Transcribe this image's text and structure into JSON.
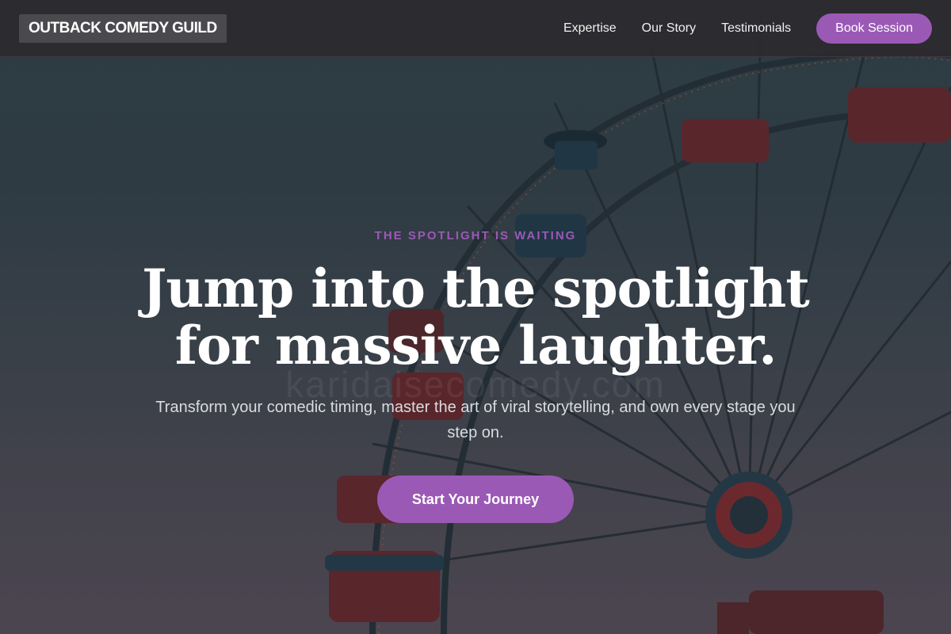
{
  "nav": {
    "brand": "OUTBACK COMEDY GUILD",
    "links": [
      "Expertise",
      "Our Story",
      "Testimonials"
    ],
    "cta_label": "Book Session"
  },
  "hero": {
    "eyebrow": "THE SPOTLIGHT IS WAITING",
    "headline_line1": "Jump into the spotlight",
    "headline_line2": "for massive laughter.",
    "subtext": "Transform your comedic timing, master the art of viral storytelling, and own every stage you step on.",
    "cta_label": "Start Your Journey",
    "watermark": "karidaisecomedy.com",
    "background_image": "ferris-wheel-at-dusk"
  },
  "colors": {
    "accent": "#9b59b6",
    "nav_bg": "#2c2a2e",
    "brand_bg": "#4a4a4e",
    "text_light": "#ffffff",
    "subtext": "#d9dce0"
  }
}
